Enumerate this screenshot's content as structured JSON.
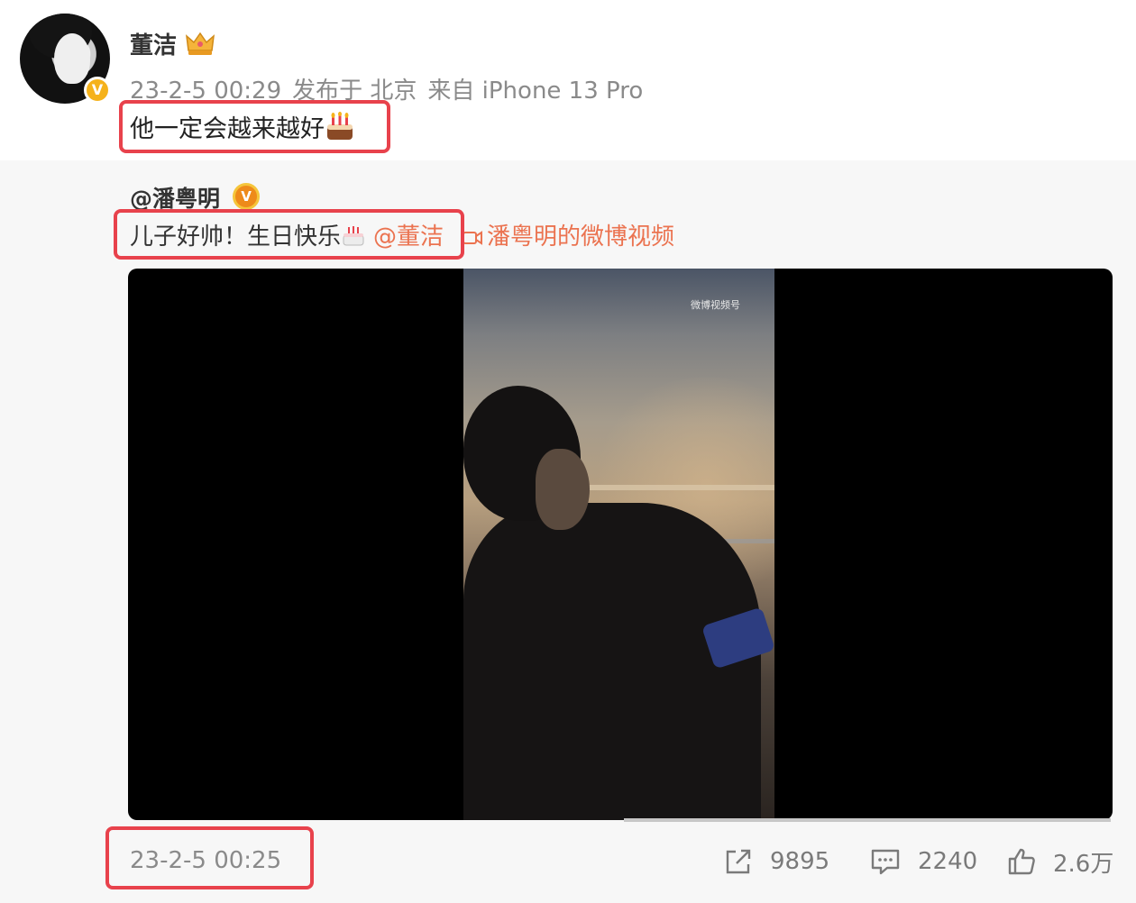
{
  "post": {
    "username": "董洁",
    "verified_badge": "V",
    "timestamp": "23-2-5 00:29",
    "location": "发布于 北京",
    "source": "来自 iPhone 13 Pro",
    "text": "他一定会越来越好",
    "emoji": "birthday-cake-icon"
  },
  "repost": {
    "username": "@潘粤明",
    "verified_badge": "V",
    "text": "儿子好帅！生日快乐",
    "mention": "@董洁",
    "video_link": "潘粤明的微博视频",
    "video_watermark": "微博视频号",
    "timestamp": "23-2-5 00:25",
    "actions": {
      "share_count": "9895",
      "comment_count": "2240",
      "like_count": "2.6万"
    }
  },
  "colors": {
    "highlight": "#e8424c",
    "link": "#eb7350",
    "meta": "#8a8a8a",
    "repost_bg": "#f7f7f7"
  }
}
